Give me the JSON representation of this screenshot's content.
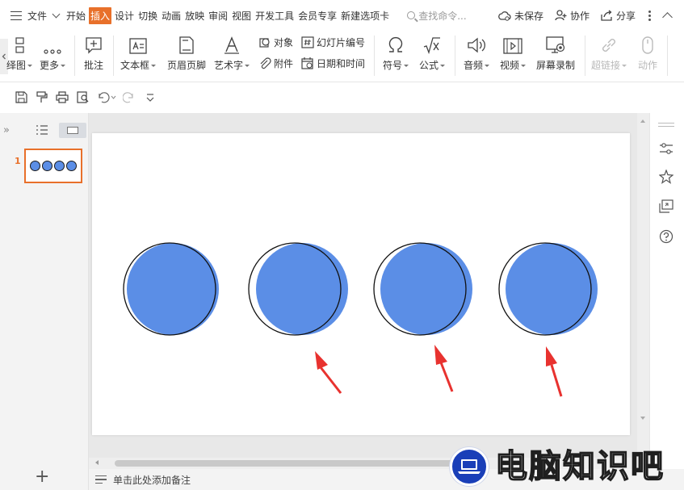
{
  "menubar": {
    "file": "文件",
    "tabs": [
      "开始",
      "插入",
      "设计",
      "切换",
      "动画",
      "放映",
      "审阅",
      "视图",
      "开发工具",
      "会员专享",
      "新建选项卡"
    ],
    "active_tab": "插入",
    "search_placeholder": "查找命令...",
    "unsaved": "未保存",
    "collab": "协作",
    "share": "分享"
  },
  "ribbon": {
    "shapes_partial": "绎图",
    "more": "更多",
    "comment": "批注",
    "textbox": "文本框",
    "header_footer": "页眉页脚",
    "wordart": "艺术字",
    "object": "对象",
    "attachment": "附件",
    "slide_number": "幻灯片编号",
    "datetime": "日期和时间",
    "symbol": "符号",
    "formula": "公式",
    "audio": "音频",
    "video": "视频",
    "screen_record": "屏幕录制",
    "hyperlink": "超链接",
    "action": "动作"
  },
  "slide_panel": {
    "slide_number": "1",
    "add_slide": "+"
  },
  "notes": {
    "placeholder": "单击此处添加备注"
  },
  "watermark": {
    "text": "电脑知识吧"
  },
  "colors": {
    "accent_orange": "#e8702a",
    "circle_fill": "#5b8ee6",
    "arrow_red": "#e8322f"
  }
}
